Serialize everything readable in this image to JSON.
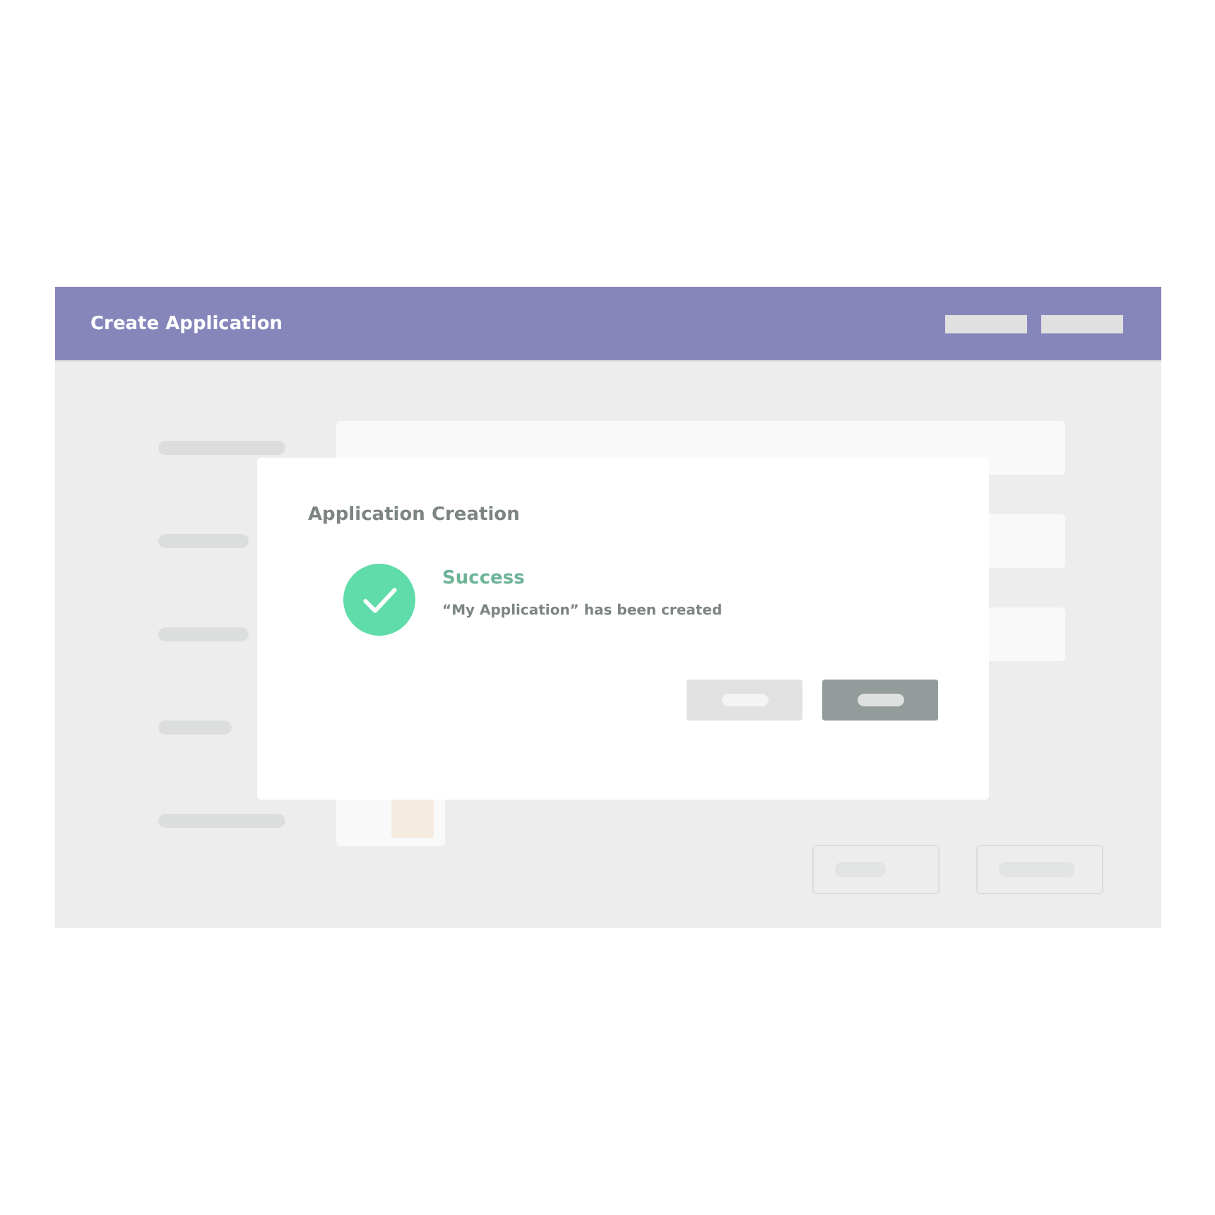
{
  "window": {
    "title": "Create Application"
  },
  "dialog": {
    "title": "Application Creation",
    "status": {
      "kind": "success",
      "heading": "Success",
      "message": "“My Application” has been created"
    }
  }
}
